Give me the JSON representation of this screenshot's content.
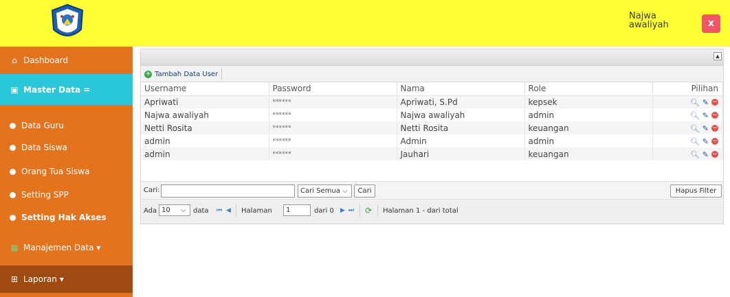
{
  "header": {
    "user_name": "Najwa awaliyah",
    "close_label": "x"
  },
  "sidebar": {
    "items": [
      {
        "label": "Dashboard",
        "icon": "home-icon"
      },
      {
        "label": "Master Data =",
        "icon": "window-icon"
      },
      {
        "label": "Data Guru",
        "icon": "dot-icon"
      },
      {
        "label": "Data Siswa",
        "icon": "dot-icon"
      },
      {
        "label": "Orang Tua Siswa",
        "icon": "dot-icon"
      },
      {
        "label": "Setting SPP",
        "icon": "dot-icon"
      },
      {
        "label": "Setting Hak Akses",
        "icon": "dot-icon"
      },
      {
        "label": "Manajemen Data ▾",
        "icon": "grid-icon"
      },
      {
        "label": "Laporan ▾",
        "icon": "table-icon"
      }
    ]
  },
  "grid": {
    "add_button": "Tambah Data User",
    "columns": [
      "Username",
      "Password",
      "Nama",
      "Role",
      "Pilihan"
    ],
    "rows": [
      {
        "username": "Apriwati",
        "password": "******",
        "nama": "Apriwati, S.Pd",
        "role": "kepsek"
      },
      {
        "username": "Najwa awaliyah",
        "password": "******",
        "nama": "Najwa awaliyah",
        "role": "admin"
      },
      {
        "username": "Netti Rosita",
        "password": "******",
        "nama": "Netti Rosita",
        "role": "keuangan"
      },
      {
        "username": "admin",
        "password": "******",
        "nama": "Admin",
        "role": "admin"
      },
      {
        "username": "admin",
        "password": "******",
        "nama": "Jauhari",
        "role": "keuangan"
      }
    ]
  },
  "search": {
    "label": "Cari:",
    "input_value": "",
    "select_value": "Cari Semua",
    "search_button": "Cari",
    "clear_button": "Hapus Filter"
  },
  "pager": {
    "prefix": "Ada",
    "page_size": "10",
    "suffix": "data",
    "page_label": "Halaman",
    "page_value": "1",
    "of_label": "dari 0",
    "status": "Halaman 1 - dari total"
  },
  "colors": {
    "topbar": "#ffff33",
    "sidebar": "#e4731e",
    "sidebar_active": "#29c7d9",
    "sidebar_dark": "#9e4a10",
    "close_button": "#f2546a"
  }
}
